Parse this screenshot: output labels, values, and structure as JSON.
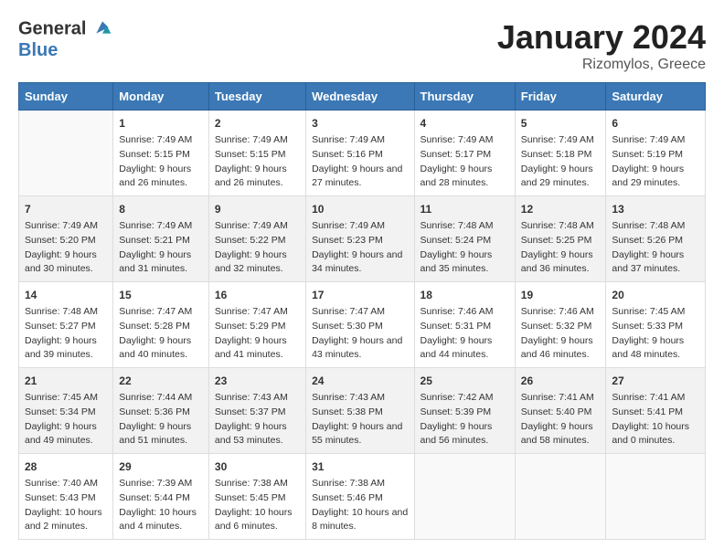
{
  "header": {
    "logo_line1": "General",
    "logo_line2": "Blue",
    "main_title": "January 2024",
    "subtitle": "Rizomylos, Greece"
  },
  "calendar": {
    "days_of_week": [
      "Sunday",
      "Monday",
      "Tuesday",
      "Wednesday",
      "Thursday",
      "Friday",
      "Saturday"
    ],
    "weeks": [
      [
        {
          "day": "",
          "sunrise": "",
          "sunset": "",
          "daylight": ""
        },
        {
          "day": "1",
          "sunrise": "Sunrise: 7:49 AM",
          "sunset": "Sunset: 5:15 PM",
          "daylight": "Daylight: 9 hours and 26 minutes."
        },
        {
          "day": "2",
          "sunrise": "Sunrise: 7:49 AM",
          "sunset": "Sunset: 5:15 PM",
          "daylight": "Daylight: 9 hours and 26 minutes."
        },
        {
          "day": "3",
          "sunrise": "Sunrise: 7:49 AM",
          "sunset": "Sunset: 5:16 PM",
          "daylight": "Daylight: 9 hours and 27 minutes."
        },
        {
          "day": "4",
          "sunrise": "Sunrise: 7:49 AM",
          "sunset": "Sunset: 5:17 PM",
          "daylight": "Daylight: 9 hours and 28 minutes."
        },
        {
          "day": "5",
          "sunrise": "Sunrise: 7:49 AM",
          "sunset": "Sunset: 5:18 PM",
          "daylight": "Daylight: 9 hours and 29 minutes."
        },
        {
          "day": "6",
          "sunrise": "Sunrise: 7:49 AM",
          "sunset": "Sunset: 5:19 PM",
          "daylight": "Daylight: 9 hours and 29 minutes."
        }
      ],
      [
        {
          "day": "7",
          "sunrise": "Sunrise: 7:49 AM",
          "sunset": "Sunset: 5:20 PM",
          "daylight": "Daylight: 9 hours and 30 minutes."
        },
        {
          "day": "8",
          "sunrise": "Sunrise: 7:49 AM",
          "sunset": "Sunset: 5:21 PM",
          "daylight": "Daylight: 9 hours and 31 minutes."
        },
        {
          "day": "9",
          "sunrise": "Sunrise: 7:49 AM",
          "sunset": "Sunset: 5:22 PM",
          "daylight": "Daylight: 9 hours and 32 minutes."
        },
        {
          "day": "10",
          "sunrise": "Sunrise: 7:49 AM",
          "sunset": "Sunset: 5:23 PM",
          "daylight": "Daylight: 9 hours and 34 minutes."
        },
        {
          "day": "11",
          "sunrise": "Sunrise: 7:48 AM",
          "sunset": "Sunset: 5:24 PM",
          "daylight": "Daylight: 9 hours and 35 minutes."
        },
        {
          "day": "12",
          "sunrise": "Sunrise: 7:48 AM",
          "sunset": "Sunset: 5:25 PM",
          "daylight": "Daylight: 9 hours and 36 minutes."
        },
        {
          "day": "13",
          "sunrise": "Sunrise: 7:48 AM",
          "sunset": "Sunset: 5:26 PM",
          "daylight": "Daylight: 9 hours and 37 minutes."
        }
      ],
      [
        {
          "day": "14",
          "sunrise": "Sunrise: 7:48 AM",
          "sunset": "Sunset: 5:27 PM",
          "daylight": "Daylight: 9 hours and 39 minutes."
        },
        {
          "day": "15",
          "sunrise": "Sunrise: 7:47 AM",
          "sunset": "Sunset: 5:28 PM",
          "daylight": "Daylight: 9 hours and 40 minutes."
        },
        {
          "day": "16",
          "sunrise": "Sunrise: 7:47 AM",
          "sunset": "Sunset: 5:29 PM",
          "daylight": "Daylight: 9 hours and 41 minutes."
        },
        {
          "day": "17",
          "sunrise": "Sunrise: 7:47 AM",
          "sunset": "Sunset: 5:30 PM",
          "daylight": "Daylight: 9 hours and 43 minutes."
        },
        {
          "day": "18",
          "sunrise": "Sunrise: 7:46 AM",
          "sunset": "Sunset: 5:31 PM",
          "daylight": "Daylight: 9 hours and 44 minutes."
        },
        {
          "day": "19",
          "sunrise": "Sunrise: 7:46 AM",
          "sunset": "Sunset: 5:32 PM",
          "daylight": "Daylight: 9 hours and 46 minutes."
        },
        {
          "day": "20",
          "sunrise": "Sunrise: 7:45 AM",
          "sunset": "Sunset: 5:33 PM",
          "daylight": "Daylight: 9 hours and 48 minutes."
        }
      ],
      [
        {
          "day": "21",
          "sunrise": "Sunrise: 7:45 AM",
          "sunset": "Sunset: 5:34 PM",
          "daylight": "Daylight: 9 hours and 49 minutes."
        },
        {
          "day": "22",
          "sunrise": "Sunrise: 7:44 AM",
          "sunset": "Sunset: 5:36 PM",
          "daylight": "Daylight: 9 hours and 51 minutes."
        },
        {
          "day": "23",
          "sunrise": "Sunrise: 7:43 AM",
          "sunset": "Sunset: 5:37 PM",
          "daylight": "Daylight: 9 hours and 53 minutes."
        },
        {
          "day": "24",
          "sunrise": "Sunrise: 7:43 AM",
          "sunset": "Sunset: 5:38 PM",
          "daylight": "Daylight: 9 hours and 55 minutes."
        },
        {
          "day": "25",
          "sunrise": "Sunrise: 7:42 AM",
          "sunset": "Sunset: 5:39 PM",
          "daylight": "Daylight: 9 hours and 56 minutes."
        },
        {
          "day": "26",
          "sunrise": "Sunrise: 7:41 AM",
          "sunset": "Sunset: 5:40 PM",
          "daylight": "Daylight: 9 hours and 58 minutes."
        },
        {
          "day": "27",
          "sunrise": "Sunrise: 7:41 AM",
          "sunset": "Sunset: 5:41 PM",
          "daylight": "Daylight: 10 hours and 0 minutes."
        }
      ],
      [
        {
          "day": "28",
          "sunrise": "Sunrise: 7:40 AM",
          "sunset": "Sunset: 5:43 PM",
          "daylight": "Daylight: 10 hours and 2 minutes."
        },
        {
          "day": "29",
          "sunrise": "Sunrise: 7:39 AM",
          "sunset": "Sunset: 5:44 PM",
          "daylight": "Daylight: 10 hours and 4 minutes."
        },
        {
          "day": "30",
          "sunrise": "Sunrise: 7:38 AM",
          "sunset": "Sunset: 5:45 PM",
          "daylight": "Daylight: 10 hours and 6 minutes."
        },
        {
          "day": "31",
          "sunrise": "Sunrise: 7:38 AM",
          "sunset": "Sunset: 5:46 PM",
          "daylight": "Daylight: 10 hours and 8 minutes."
        },
        {
          "day": "",
          "sunrise": "",
          "sunset": "",
          "daylight": ""
        },
        {
          "day": "",
          "sunrise": "",
          "sunset": "",
          "daylight": ""
        },
        {
          "day": "",
          "sunrise": "",
          "sunset": "",
          "daylight": ""
        }
      ]
    ]
  }
}
